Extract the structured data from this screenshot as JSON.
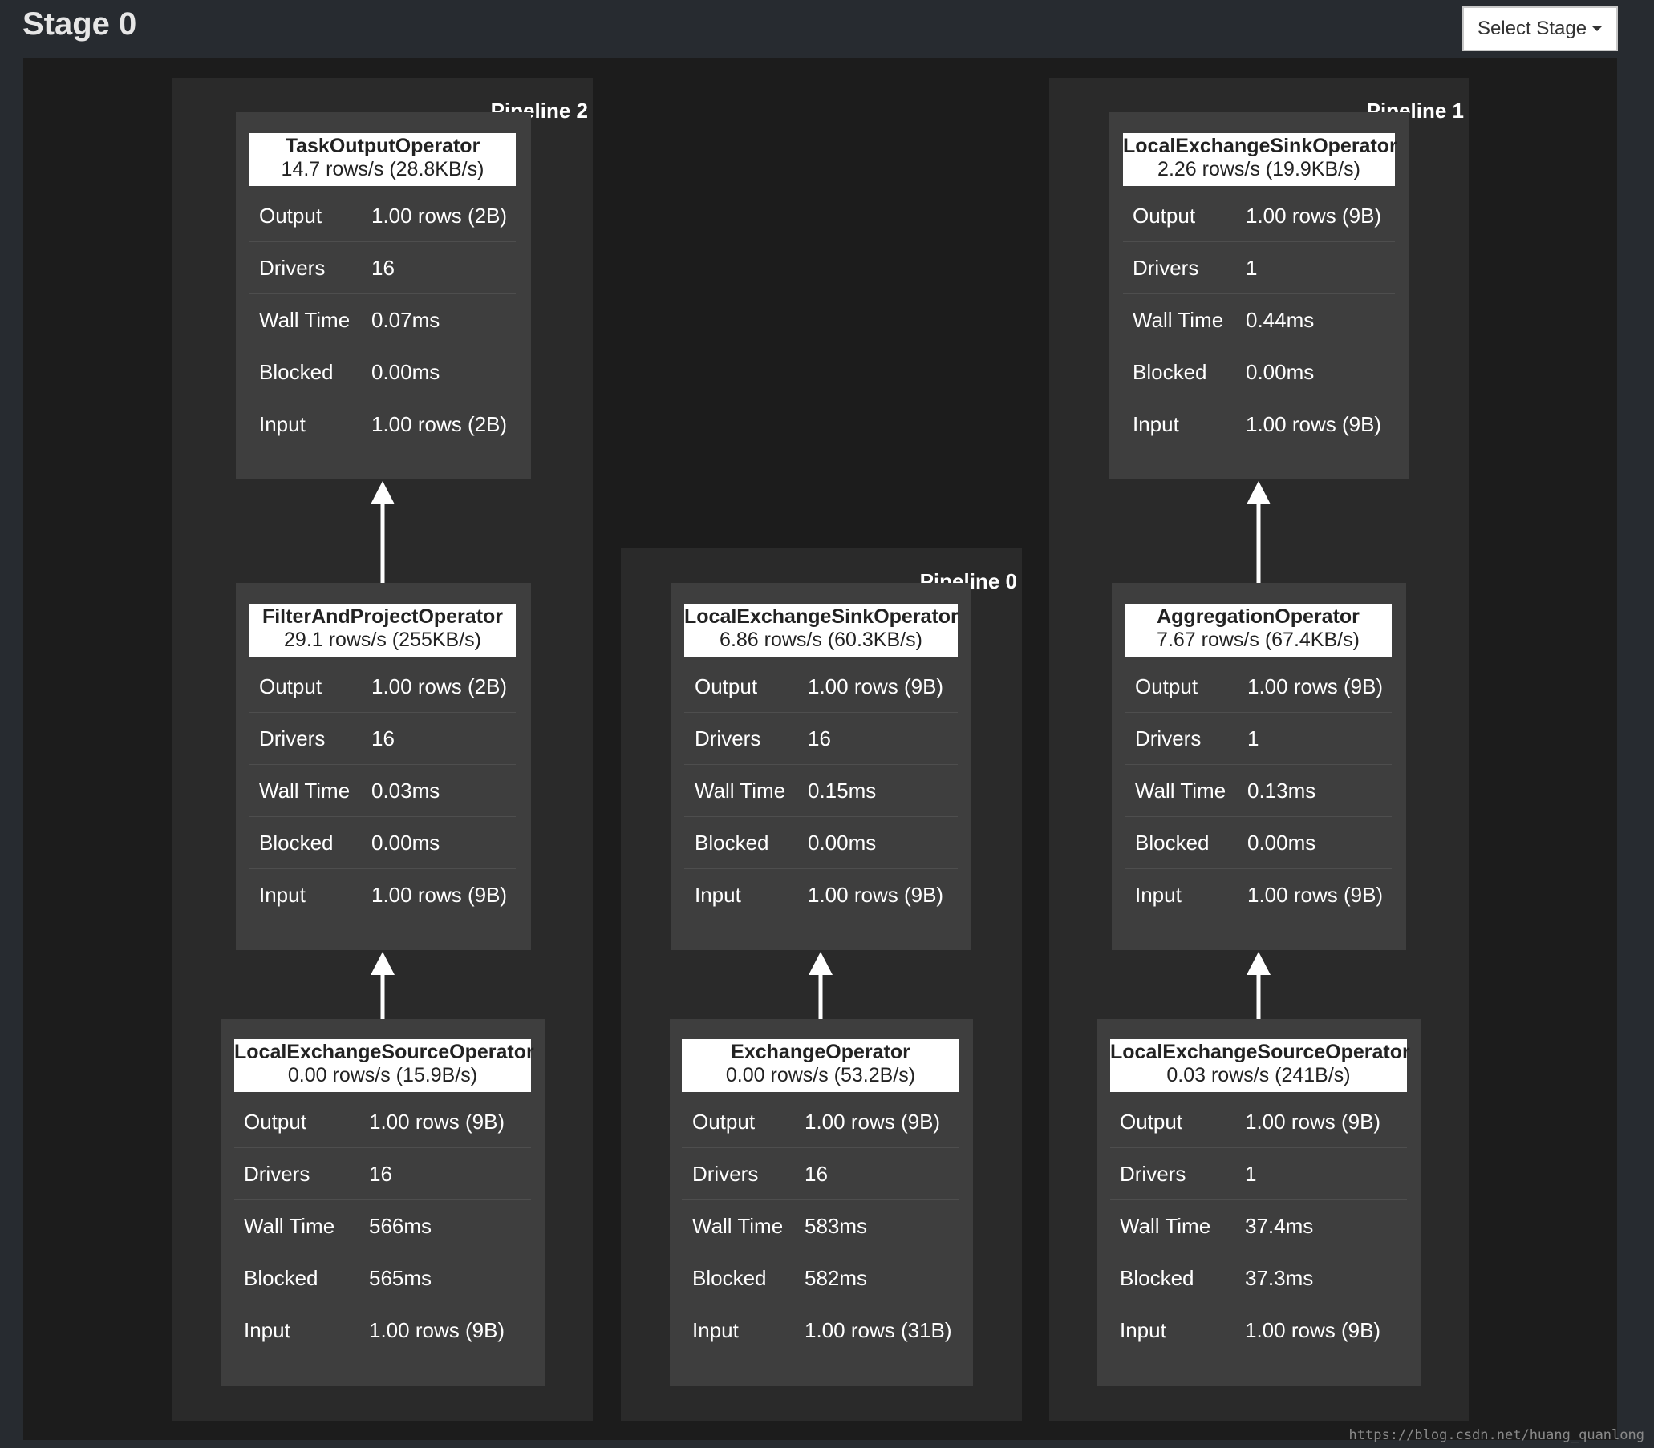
{
  "header": {
    "title": "Stage 0",
    "select_stage_label": "Select Stage"
  },
  "pipelines": [
    {
      "label": "Pipeline 2",
      "operators": [
        {
          "name": "TaskOutputOperator",
          "rate": "14.7 rows/s (28.8KB/s)",
          "stats": [
            {
              "label": "Output",
              "value": "1.00 rows (2B)"
            },
            {
              "label": "Drivers",
              "value": "16"
            },
            {
              "label": "Wall Time",
              "value": "0.07ms"
            },
            {
              "label": "Blocked",
              "value": "0.00ms"
            },
            {
              "label": "Input",
              "value": "1.00 rows (2B)"
            }
          ]
        },
        {
          "name": "FilterAndProjectOperator",
          "rate": "29.1 rows/s (255KB/s)",
          "stats": [
            {
              "label": "Output",
              "value": "1.00 rows (2B)"
            },
            {
              "label": "Drivers",
              "value": "16"
            },
            {
              "label": "Wall Time",
              "value": "0.03ms"
            },
            {
              "label": "Blocked",
              "value": "0.00ms"
            },
            {
              "label": "Input",
              "value": "1.00 rows (9B)"
            }
          ]
        },
        {
          "name": "LocalExchangeSourceOperator",
          "rate": "0.00 rows/s (15.9B/s)",
          "stats": [
            {
              "label": "Output",
              "value": "1.00 rows (9B)"
            },
            {
              "label": "Drivers",
              "value": "16"
            },
            {
              "label": "Wall Time",
              "value": "566ms"
            },
            {
              "label": "Blocked",
              "value": "565ms"
            },
            {
              "label": "Input",
              "value": "1.00 rows (9B)"
            }
          ]
        }
      ]
    },
    {
      "label": "Pipeline 0",
      "operators": [
        {
          "name": "LocalExchangeSinkOperator",
          "rate": "6.86 rows/s (60.3KB/s)",
          "stats": [
            {
              "label": "Output",
              "value": "1.00 rows (9B)"
            },
            {
              "label": "Drivers",
              "value": "16"
            },
            {
              "label": "Wall Time",
              "value": "0.15ms"
            },
            {
              "label": "Blocked",
              "value": "0.00ms"
            },
            {
              "label": "Input",
              "value": "1.00 rows (9B)"
            }
          ]
        },
        {
          "name": "ExchangeOperator",
          "rate": "0.00 rows/s (53.2B/s)",
          "stats": [
            {
              "label": "Output",
              "value": "1.00 rows (9B)"
            },
            {
              "label": "Drivers",
              "value": "16"
            },
            {
              "label": "Wall Time",
              "value": "583ms"
            },
            {
              "label": "Blocked",
              "value": "582ms"
            },
            {
              "label": "Input",
              "value": "1.00 rows (31B)"
            }
          ]
        }
      ]
    },
    {
      "label": "Pipeline 1",
      "operators": [
        {
          "name": "LocalExchangeSinkOperator",
          "rate": "2.26 rows/s (19.9KB/s)",
          "stats": [
            {
              "label": "Output",
              "value": "1.00 rows (9B)"
            },
            {
              "label": "Drivers",
              "value": "1"
            },
            {
              "label": "Wall Time",
              "value": "0.44ms"
            },
            {
              "label": "Blocked",
              "value": "0.00ms"
            },
            {
              "label": "Input",
              "value": "1.00 rows (9B)"
            }
          ]
        },
        {
          "name": "AggregationOperator",
          "rate": "7.67 rows/s (67.4KB/s)",
          "stats": [
            {
              "label": "Output",
              "value": "1.00 rows (9B)"
            },
            {
              "label": "Drivers",
              "value": "1"
            },
            {
              "label": "Wall Time",
              "value": "0.13ms"
            },
            {
              "label": "Blocked",
              "value": "0.00ms"
            },
            {
              "label": "Input",
              "value": "1.00 rows (9B)"
            }
          ]
        },
        {
          "name": "LocalExchangeSourceOperator",
          "rate": "0.03 rows/s (241B/s)",
          "stats": [
            {
              "label": "Output",
              "value": "1.00 rows (9B)"
            },
            {
              "label": "Drivers",
              "value": "1"
            },
            {
              "label": "Wall Time",
              "value": "37.4ms"
            },
            {
              "label": "Blocked",
              "value": "37.3ms"
            },
            {
              "label": "Input",
              "value": "1.00 rows (9B)"
            }
          ]
        }
      ]
    }
  ],
  "watermark": "https://blog.csdn.net/huang_quanlong"
}
